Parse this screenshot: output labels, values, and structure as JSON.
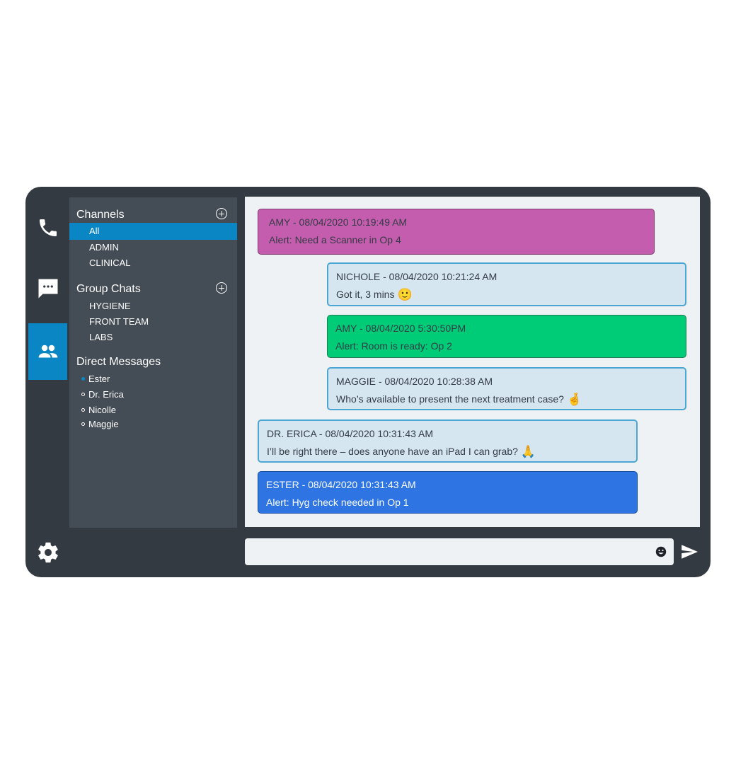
{
  "rail": {
    "icons": [
      "phone-icon",
      "chat-bubble-icon",
      "people-icon",
      "gear-icon"
    ],
    "active": "people-icon",
    "accent": "#0a86c4"
  },
  "sidebar": {
    "channels": {
      "title": "Channels",
      "items": [
        "All",
        "ADMIN",
        "CLINICAL"
      ],
      "selected": "All"
    },
    "group_chats": {
      "title": "Group Chats",
      "items": [
        "HYGIENE",
        "FRONT TEAM",
        "LABS"
      ]
    },
    "direct_messages": {
      "title": "Direct Messages",
      "items": [
        {
          "name": "Ester",
          "status": "online"
        },
        {
          "name": "Dr. Erica",
          "status": "offline"
        },
        {
          "name": "Nicolle",
          "status": "offline"
        },
        {
          "name": "Maggie",
          "status": "offline"
        }
      ]
    }
  },
  "messages": [
    {
      "header": "AMY - 08/04/2020 10:19:49 AM",
      "text": "Alert: Need a Scanner in Op 4",
      "emoji": "",
      "color": "#c55dae"
    },
    {
      "header": "NICHOLE - 08/04/2020 10:21:24 AM",
      "text": "Got it, 3 mins",
      "emoji": "🙂",
      "color": "#d5e6f0"
    },
    {
      "header": "AMY - 08/04/2020 5:30:50PM",
      "text": "Alert: Room is ready: Op 2",
      "emoji": "",
      "color": "#00cc78"
    },
    {
      "header": "MAGGIE - 08/04/2020 10:28:38 AM",
      "text": "Who’s available to present the next treatment case?",
      "emoji": "🤞",
      "color": "#d5e6f0"
    },
    {
      "header": "DR. ERICA  - 08/04/2020 10:31:43 AM",
      "text": "I’ll be right there – does anyone have an iPad I can grab?",
      "emoji": "🙏",
      "color": "#d5e6f0"
    },
    {
      "header": "ESTER  - 08/04/2020 10:31:43 AM",
      "text": "Alert: Hyg check needed in Op 1",
      "emoji": "",
      "color": "#2e74e3"
    }
  ],
  "composer": {
    "value": "",
    "placeholder": "",
    "emoji_icon": "smiley-icon",
    "send_icon": "send-icon"
  }
}
